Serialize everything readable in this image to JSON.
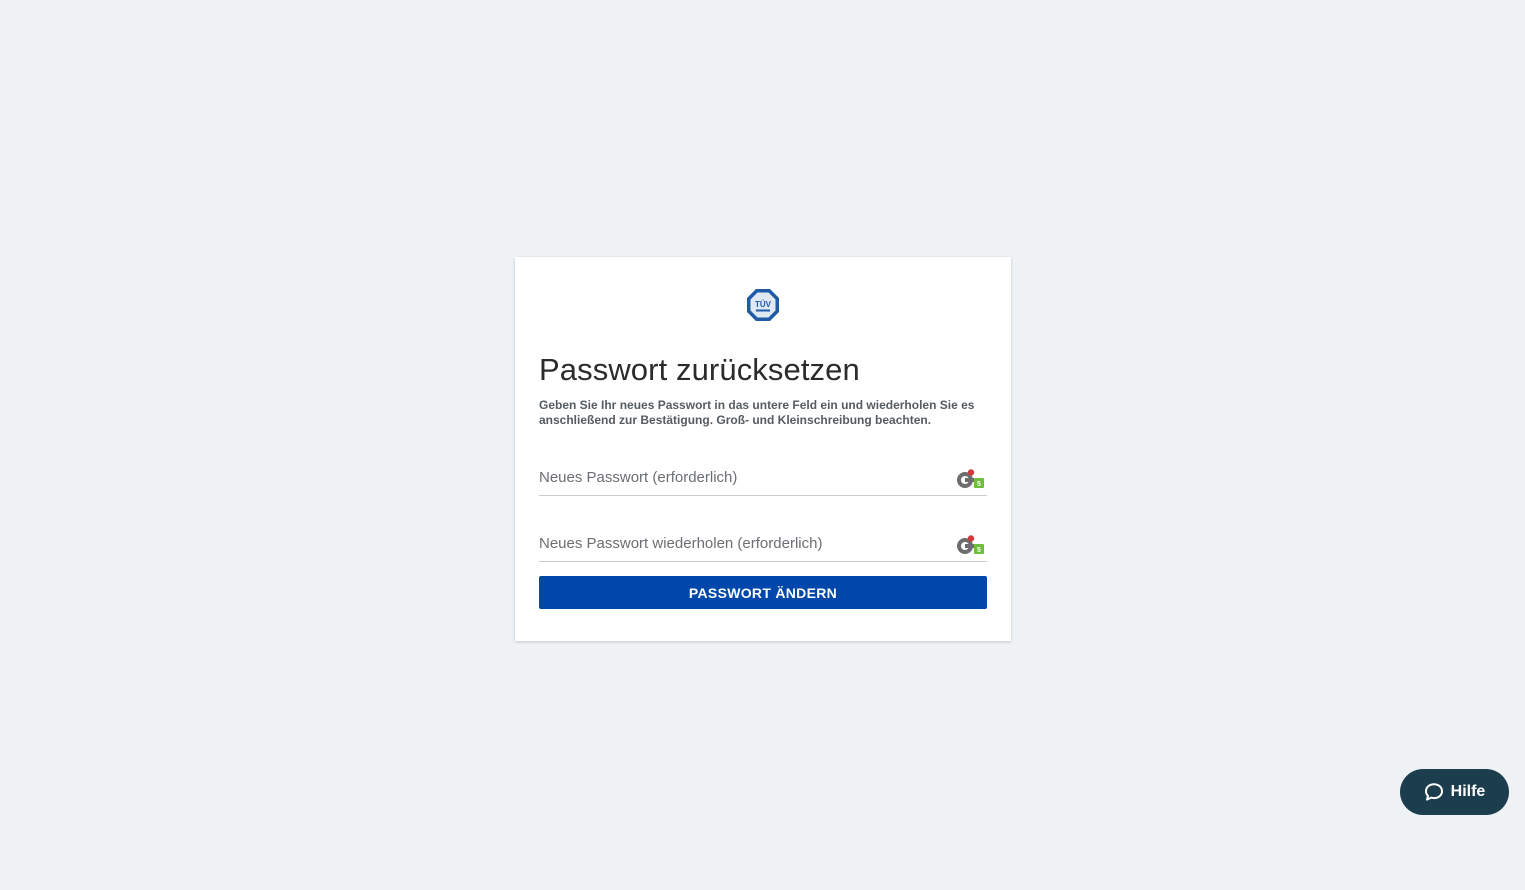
{
  "card": {
    "logo_icon": "tuv-logo-icon",
    "logo_text": "TÜV",
    "title": "Passwort zurücksetzen",
    "description": "Geben Sie Ihr neues Passwort in das untere Feld ein und wiederholen Sie es anschließend zur Bestätigung. Groß- und Kleinschreibung beachten.",
    "fields": [
      {
        "placeholder": "Neues Passwort (erforderlich)",
        "value": "",
        "icon": "password-manager-icon"
      },
      {
        "placeholder": "Neues Passwort wiederholen (erforderlich)",
        "value": "",
        "icon": "password-manager-icon"
      }
    ],
    "submit_label": "PASSWORT ÄNDERN"
  },
  "help": {
    "label": "Hilfe",
    "icon": "chat-bubble-icon"
  },
  "colors": {
    "background": "#eef2f5",
    "primary_button": "#0047ab",
    "help_button": "#1c3d4e",
    "logo_blue": "#1f5aa6"
  }
}
